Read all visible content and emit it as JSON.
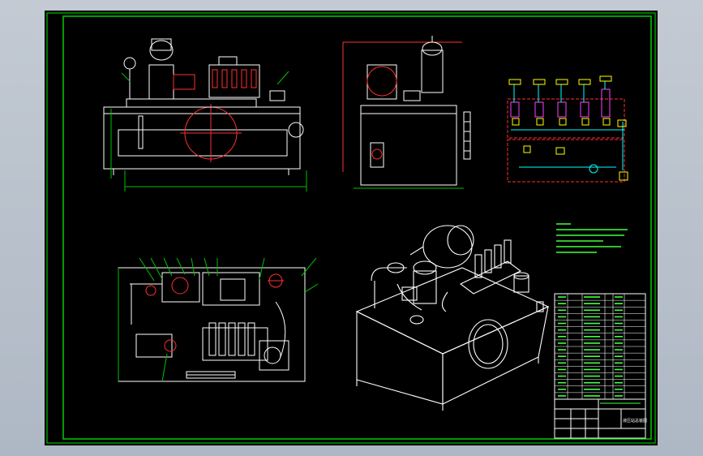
{
  "drawing": {
    "background": "#000000",
    "frame_color": "#00c000",
    "line_color": "#ffffff",
    "accent_red": "#ff3030",
    "accent_magenta": "#ff40ff",
    "accent_yellow": "#ffff00",
    "accent_cyan": "#00ffff",
    "text_green": "#40ff40"
  },
  "views": [
    {
      "name": "front-view"
    },
    {
      "name": "side-view"
    },
    {
      "name": "top-view"
    },
    {
      "name": "isometric-view"
    },
    {
      "name": "hydraulic-schematic"
    }
  ],
  "technical_notes": {
    "line_count": 5
  },
  "title_block": {
    "drawing_title": "液压站总装图"
  },
  "parts_list": {
    "row_count": 16
  }
}
